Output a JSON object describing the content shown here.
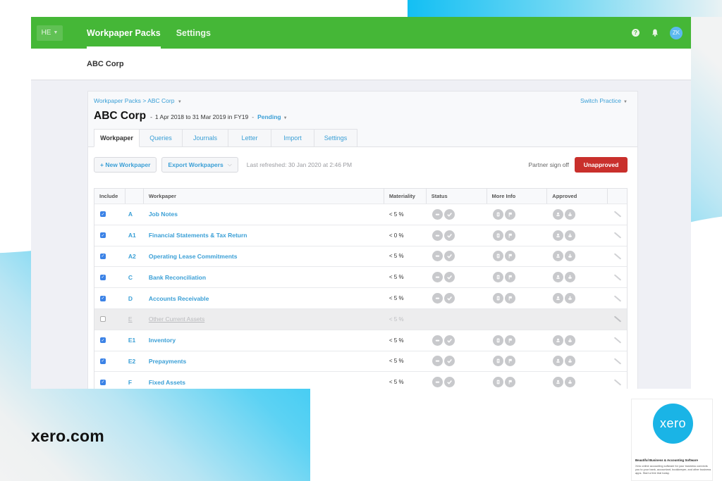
{
  "topnav": {
    "org_switcher": "HE",
    "tabs": [
      {
        "label": "Workpaper Packs",
        "active": true
      },
      {
        "label": "Settings",
        "active": false
      }
    ],
    "help_icon": "?",
    "avatar_initials": "ZK"
  },
  "subheader": {
    "org_name": "ABC Corp"
  },
  "panel": {
    "breadcrumb": {
      "root": "Workpaper Packs",
      "separator": ">",
      "current": "ABC Corp"
    },
    "switch_practice": "Switch Practice",
    "title": "ABC Corp",
    "period": "1 Apr 2018 to 31 Mar 2019 in FY19",
    "status": "Pending",
    "tabs": [
      {
        "label": "Workpaper",
        "active": true
      },
      {
        "label": "Queries",
        "active": false
      },
      {
        "label": "Journals",
        "active": false
      },
      {
        "label": "Letter",
        "active": false
      },
      {
        "label": "Import",
        "active": false
      },
      {
        "label": "Settings",
        "active": false
      }
    ],
    "toolbar": {
      "new_workpaper": "+ New Workpaper",
      "export_workpapers": "Export Workpapers",
      "last_refreshed": "Last refreshed: 30 Jan 2020 at 2:46 PM",
      "partner_sign_off_label": "Partner sign off",
      "sign_off_status": "Unapproved",
      "sign_off_color": "#c9302c"
    }
  },
  "table": {
    "columns": [
      "Include",
      "",
      "Workpaper",
      "Materiality",
      "Status",
      "More Info",
      "Approved",
      ""
    ],
    "rows": [
      {
        "included": true,
        "code": "A",
        "name": "Job Notes",
        "materiality": "< 5 %"
      },
      {
        "included": true,
        "code": "A1",
        "name": "Financial Statements & Tax Return",
        "materiality": "< 0 %"
      },
      {
        "included": true,
        "code": "A2",
        "name": "Operating Lease Commitments",
        "materiality": "< 5 %"
      },
      {
        "included": true,
        "code": "C",
        "name": "Bank Reconciliation",
        "materiality": "< 5 %"
      },
      {
        "included": true,
        "code": "D",
        "name": "Accounts Receivable",
        "materiality": "< 5 %"
      },
      {
        "included": false,
        "code": "E",
        "name": "Other Current Assets",
        "materiality": "< 5 %"
      },
      {
        "included": true,
        "code": "E1",
        "name": "Inventory",
        "materiality": "< 5 %"
      },
      {
        "included": true,
        "code": "E2",
        "name": "Prepayments",
        "materiality": "< 5 %"
      },
      {
        "included": true,
        "code": "F",
        "name": "Fixed Assets",
        "materiality": "< 5 %"
      }
    ]
  },
  "footer": {
    "domain": "xero.com",
    "card": {
      "logo_text": "xero",
      "title": "Beautiful Business & Accounting Software",
      "description": "Xero online accounting software for your business connects you to your bank, accountant, bookkeeper, and other business apps. Start a free trial today."
    }
  },
  "colors": {
    "brand_green": "#45b737",
    "link_blue": "#3a9fd6",
    "xero_blue": "#1ab4e6"
  }
}
